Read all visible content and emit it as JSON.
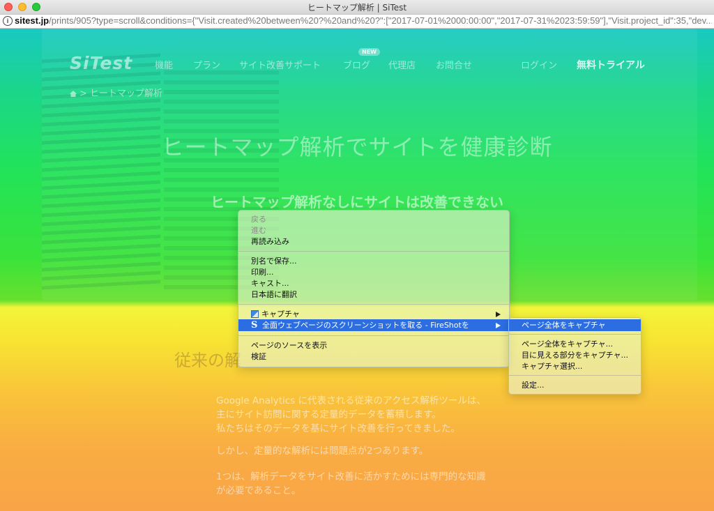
{
  "window": {
    "title": "ヒートマップ解析 | SiTest"
  },
  "address_bar": {
    "host": "sitest.jp",
    "path": "/prints/905?type=scroll&conditions={\"Visit.created%20between%20?%20and%20?\":[\"2017-07-01%2000:00:00\",\"2017-07-31%2023:59:59\"],\"Visit.project_id\":35,\"dev..."
  },
  "site": {
    "logo": "SiTest",
    "nav": [
      "機能",
      "プラン",
      "サイト改善サポート",
      "ブログ",
      "代理店",
      "お問合せ"
    ],
    "new_badge": "NEW",
    "login": "ログイン",
    "trial": "無料トライアル",
    "breadcrumb_sep": ">",
    "breadcrumb": "ヒートマップ解析",
    "hero_title": "ヒートマップ解析でサイトを健康診断",
    "hero_subtitle": "ヒートマップ解析なしにサイトは改善できない",
    "section_title": "従来の解",
    "section_title_right": "",
    "paragraphs": [
      "Google Analytics に代表される従来のアクセス解析ツールは、",
      "主にサイト訪問に関する定量的データを蓄積します。",
      "私たちはそのデータを基にサイト改善を行ってきました。",
      "しかし、定量的な解析には問題点が2つあります。",
      "1つは、解析データをサイト改善に活かすためには専門的な知識",
      "が必要であること。"
    ]
  },
  "context_menu": {
    "back": "戻る",
    "forward": "進む",
    "reload": "再読み込み",
    "save_as": "別名で保存...",
    "print": "印刷...",
    "cast": "キャスト...",
    "translate": "日本語に翻訳",
    "capture": "キャプチャ",
    "fireshot": "全面ウェブページのスクリーンショットを取る - FireShotを",
    "view_source": "ページのソースを表示",
    "inspect": "検証"
  },
  "submenu": {
    "capture_full": "ページ全体をキャプチャ",
    "capture_full_more": "ページ全体をキャプチャ...",
    "capture_visible": "目に見える部分をキャプチャ...",
    "capture_selection": "キャプチャ選択...",
    "settings": "設定..."
  }
}
